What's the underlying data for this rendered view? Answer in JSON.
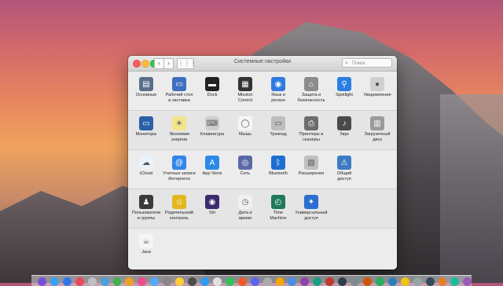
{
  "window": {
    "title": "Системные настройки",
    "search_placeholder": "Поиск",
    "nav_back": "‹",
    "nav_forward": "›",
    "grid": "⋮⋮⋮"
  },
  "rows": [
    [
      {
        "label": "Основные",
        "icon": "general-icon",
        "color": "#5a6e8c"
      },
      {
        "label": "Рабочий стол\nи заставка",
        "icon": "desktop-icon",
        "color": "#3f6fc0"
      },
      {
        "label": "Dock",
        "icon": "dock-icon",
        "color": "#222222"
      },
      {
        "label": "Mission\nControl",
        "icon": "mission-control-icon",
        "color": "#333333"
      },
      {
        "label": "Язык и\nрегион",
        "icon": "language-icon",
        "color": "#2f7be0"
      },
      {
        "label": "Защита и\nбезопасность",
        "icon": "security-icon",
        "color": "#8c8c8c"
      },
      {
        "label": "Spotlight",
        "icon": "spotlight-icon",
        "color": "#2a7fe0"
      },
      {
        "label": "Уведомления",
        "icon": "notifications-icon",
        "color": "#d0d0d0"
      }
    ],
    [
      {
        "label": "Мониторы",
        "icon": "displays-icon",
        "color": "#2b5fa8"
      },
      {
        "label": "Экономия\nэнергии",
        "icon": "energy-saver-icon",
        "color": "#f3e58c"
      },
      {
        "label": "Клавиатура",
        "icon": "keyboard-icon",
        "color": "#cfcfcf"
      },
      {
        "label": "Мышь",
        "icon": "mouse-icon",
        "color": "#f5f5f5"
      },
      {
        "label": "Трекпад",
        "icon": "trackpad-icon",
        "color": "#bdbdbd"
      },
      {
        "label": "Принтеры и\nсканеры",
        "icon": "printers-icon",
        "color": "#6c6c6c"
      },
      {
        "label": "Звук",
        "icon": "sound-icon",
        "color": "#4a4a4a"
      },
      {
        "label": "Загрузочный\nдиск",
        "icon": "startup-disk-icon",
        "color": "#9a9a9a"
      }
    ],
    [
      {
        "label": "iCloud",
        "icon": "icloud-icon",
        "color": "#e9f1fb"
      },
      {
        "label": "Учетные записи\nИнтернета",
        "icon": "internet-accounts-icon",
        "color": "#2f86e8"
      },
      {
        "label": "App Store",
        "icon": "app-store-icon",
        "color": "#2a8ae6"
      },
      {
        "label": "Сеть",
        "icon": "network-icon",
        "color": "#5a6aa8"
      },
      {
        "label": "Bluetooth",
        "icon": "bluetooth-icon",
        "color": "#1f6fd0"
      },
      {
        "label": "Расширения",
        "icon": "extensions-icon",
        "color": "#bfbfbf"
      },
      {
        "label": "Общий\nдоступ",
        "icon": "sharing-icon",
        "color": "#3d7cc4"
      }
    ],
    [
      {
        "label": "Пользователи\nи группы",
        "icon": "users-groups-icon",
        "color": "#3a3a3a"
      },
      {
        "label": "Родительский\nконтроль",
        "icon": "parental-controls-icon",
        "color": "#e3b81c"
      },
      {
        "label": "Siri",
        "icon": "siri-icon",
        "color": "#3b2a6e"
      },
      {
        "label": "Дата и\nвремя",
        "icon": "date-time-icon",
        "color": "#f0f0f0"
      },
      {
        "label": "Time\nMachine",
        "icon": "time-machine-icon",
        "color": "#1f7a5a"
      },
      {
        "label": "Универсальный\nдоступ",
        "icon": "accessibility-icon",
        "color": "#2a6fd0"
      }
    ],
    [
      {
        "label": "Java",
        "icon": "java-icon",
        "color": "#f5f5f5"
      }
    ]
  ],
  "dock": {
    "colors": [
      "#7a4fd6",
      "#3aa0f0",
      "#2f78e8",
      "#e84a5a",
      "#c0c0c0",
      "#4aa0e0",
      "#39b34a",
      "#f0a020",
      "#e94e8a",
      "#55aaff",
      "#888888",
      "#ffcc33",
      "#4c4c4c",
      "#2d9bf0",
      "#e0e0e0",
      "#36c05a",
      "#f05a28",
      "#5865f2",
      "#aaaaaa",
      "#ffa500",
      "#4a90e2",
      "#8e44ad",
      "#16a085",
      "#c0392b",
      "#2c3e50",
      "#7f8c8d",
      "#d35400",
      "#27ae60",
      "#2980b9",
      "#f1c40f",
      "#95a5a6",
      "#34495e",
      "#e67e22",
      "#1abc9c",
      "#9b59b6"
    ]
  }
}
